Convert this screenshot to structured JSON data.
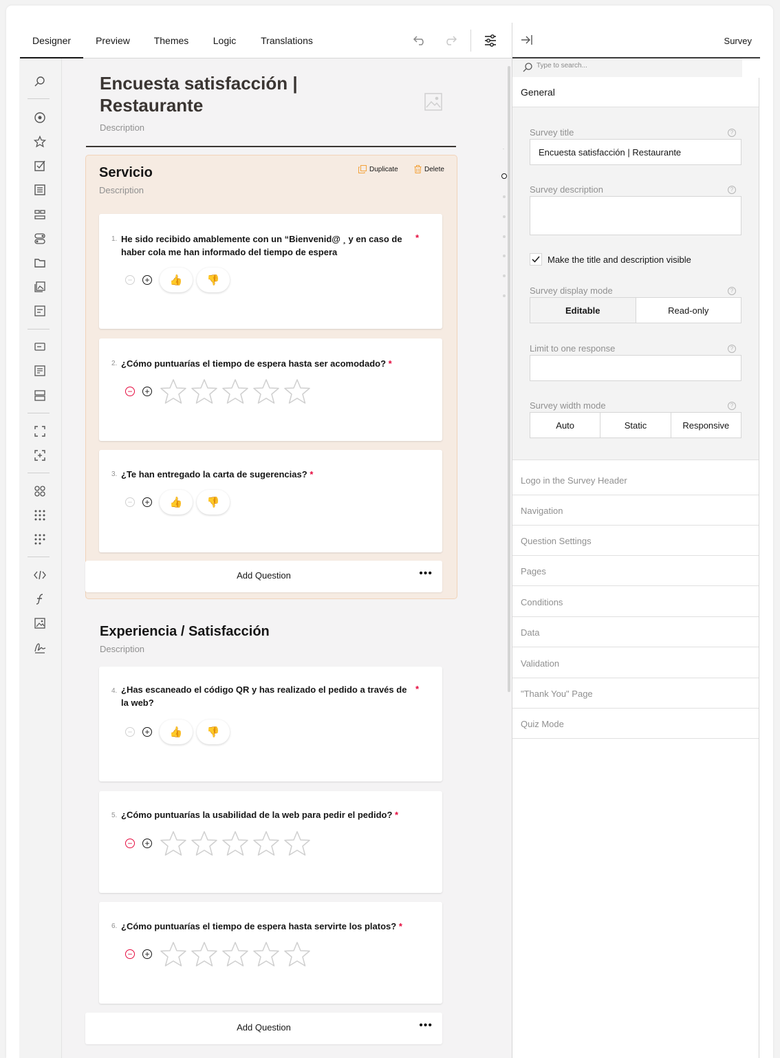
{
  "tabs": [
    "Designer",
    "Preview",
    "Themes",
    "Logic",
    "Translations"
  ],
  "survey": {
    "title": "Encuesta satisfacción | Restaurante",
    "description": "Description"
  },
  "pages": [
    {
      "title": "Servicio",
      "description": "Description",
      "duplicate_label": "Duplicate",
      "delete_label": "Delete",
      "add_question_label": "Add Question",
      "questions": [
        {
          "num": "1.",
          "text": "He sido recibido amablemente con un “Bienvenid@ ¸ y en caso de haber cola me han informado del tiempo de espera",
          "type": "thumbs"
        },
        {
          "num": "2.",
          "text": "¿Cómo puntuarías el tiempo de espera hasta ser acomodado?",
          "type": "stars"
        },
        {
          "num": "3.",
          "text": "¿Te han entregado la carta de sugerencias?",
          "type": "thumbs"
        }
      ]
    },
    {
      "title": "Experiencia / Satisfacción",
      "description": "Description",
      "add_question_label": "Add Question",
      "questions": [
        {
          "num": "4.",
          "text": "¿Has escaneado el código QR y has realizado el pedido a través de la web?",
          "type": "thumbs"
        },
        {
          "num": "5.",
          "text": "¿Cómo puntuarías la usabilidad de la web para pedir el pedido?",
          "type": "stars"
        },
        {
          "num": "6.",
          "text": "¿Cómo puntuarías el tiempo de espera hasta servirte los platos?",
          "type": "stars"
        }
      ]
    }
  ],
  "required_mark": "*",
  "thumb_up": "👍",
  "thumb_down": "👎",
  "right_panel": {
    "header_title": "Survey",
    "search_placeholder": "Type to search...",
    "general_label": "General",
    "survey_title_label": "Survey title",
    "survey_title_value": "Encuesta satisfacción | Restaurante",
    "survey_description_label": "Survey description",
    "visible_checkbox_label": "Make the title and description visible",
    "display_mode_label": "Survey display mode",
    "display_mode_options": [
      "Editable",
      "Read-only"
    ],
    "limit_label": "Limit to one response",
    "width_mode_label": "Survey width mode",
    "width_mode_options": [
      "Auto",
      "Static",
      "Responsive"
    ],
    "help_glyph": "?",
    "sections": [
      "Logo in the Survey Header",
      "Navigation",
      "Question Settings",
      "Pages",
      "Conditions",
      "Data",
      "Validation",
      "\"Thank You\" Page",
      "Quiz Mode"
    ]
  },
  "colors": {
    "accent": "#e50a3e",
    "page_bg": "#f6ebe2",
    "page_border": "#f1d3b9",
    "action_orange": "#f3a23b"
  }
}
